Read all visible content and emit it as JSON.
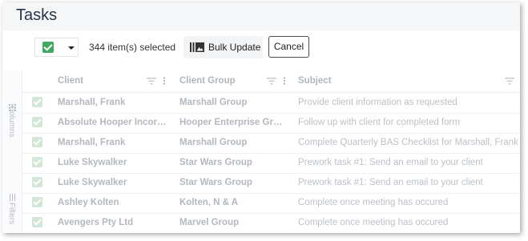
{
  "page": {
    "title": "Tasks"
  },
  "toolbar": {
    "selected_text": "344 item(s) selected",
    "bulk_update_label": "Bulk Update",
    "cancel_label": "Cancel",
    "accent_color": "#3ea861"
  },
  "side_panel": {
    "columns_label": "Columns",
    "filters_label": "Filters"
  },
  "grid": {
    "columns": [
      {
        "label": "Client"
      },
      {
        "label": "Client Group"
      },
      {
        "label": "Subject"
      }
    ],
    "rows": [
      {
        "checked": true,
        "client": "Marshall, Frank",
        "group": "Marshall Group",
        "subject": "Provide client information as requested"
      },
      {
        "checked": true,
        "client": "Absolute Hooper Incorpor...",
        "group": "Hooper Enterprise Group",
        "subject": "Follow up with client for completed form"
      },
      {
        "checked": true,
        "client": "Marshall, Frank",
        "group": "Marshall Group",
        "subject": "Complete Quarterly BAS Checklist for Marshall, Frank"
      },
      {
        "checked": true,
        "client": "Luke Skywalker",
        "group": "Star Wars Group",
        "subject": "Prework task #1: Send an email to your client"
      },
      {
        "checked": true,
        "client": "Luke Skywalker",
        "group": "Star Wars Group",
        "subject": "Prework task #1: Send an email to your client"
      },
      {
        "checked": true,
        "client": "Ashley Kolten",
        "group": "Kolten, N & A",
        "subject": "Complete once meeting has occured"
      },
      {
        "checked": true,
        "client": "Avengers Pty Ltd",
        "group": "Marvel Group",
        "subject": "Complete once meeting has occured"
      }
    ]
  }
}
